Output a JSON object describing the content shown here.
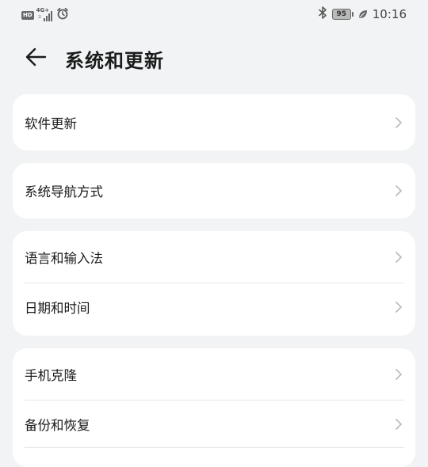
{
  "status_bar": {
    "hd": "HD",
    "network": "4G+",
    "network_sub": "1l",
    "battery": "95",
    "time": "10:16"
  },
  "header": {
    "title": "系统和更新"
  },
  "cards": [
    {
      "items": [
        {
          "label": "软件更新"
        }
      ]
    },
    {
      "items": [
        {
          "label": "系统导航方式"
        }
      ]
    },
    {
      "items": [
        {
          "label": "语言和输入法"
        },
        {
          "label": "日期和时间"
        }
      ]
    },
    {
      "items": [
        {
          "label": "手机克隆"
        },
        {
          "label": "备份和恢复"
        }
      ]
    }
  ],
  "icons": {
    "back": "arrow-left-icon",
    "chevron": "chevron-right-icon",
    "alarm": "alarm-icon",
    "bluetooth": "bluetooth-icon",
    "leaf": "eco-mode-icon"
  }
}
